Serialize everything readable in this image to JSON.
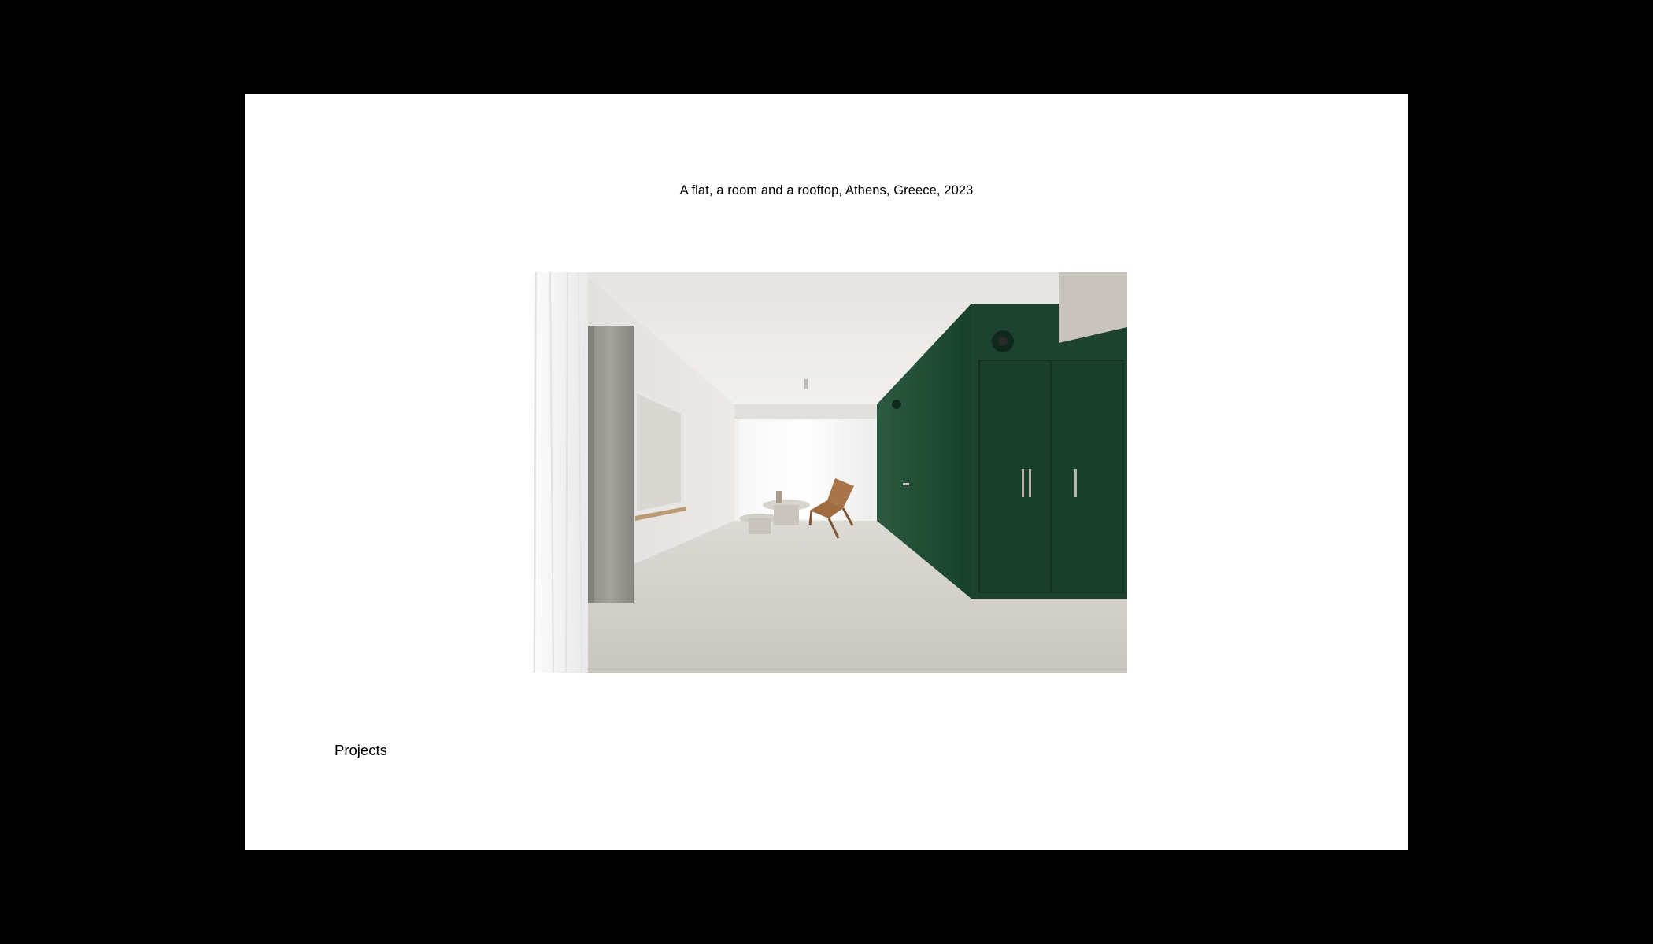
{
  "project": {
    "caption": "A flat, a room and a rooftop, Athens, Greece, 2023"
  },
  "nav": {
    "projects_label": "Projects"
  },
  "colors": {
    "backdrop": "#000000",
    "page": "#ffffff",
    "text": "#000000",
    "accent_wall_green": "#1f4a32"
  }
}
